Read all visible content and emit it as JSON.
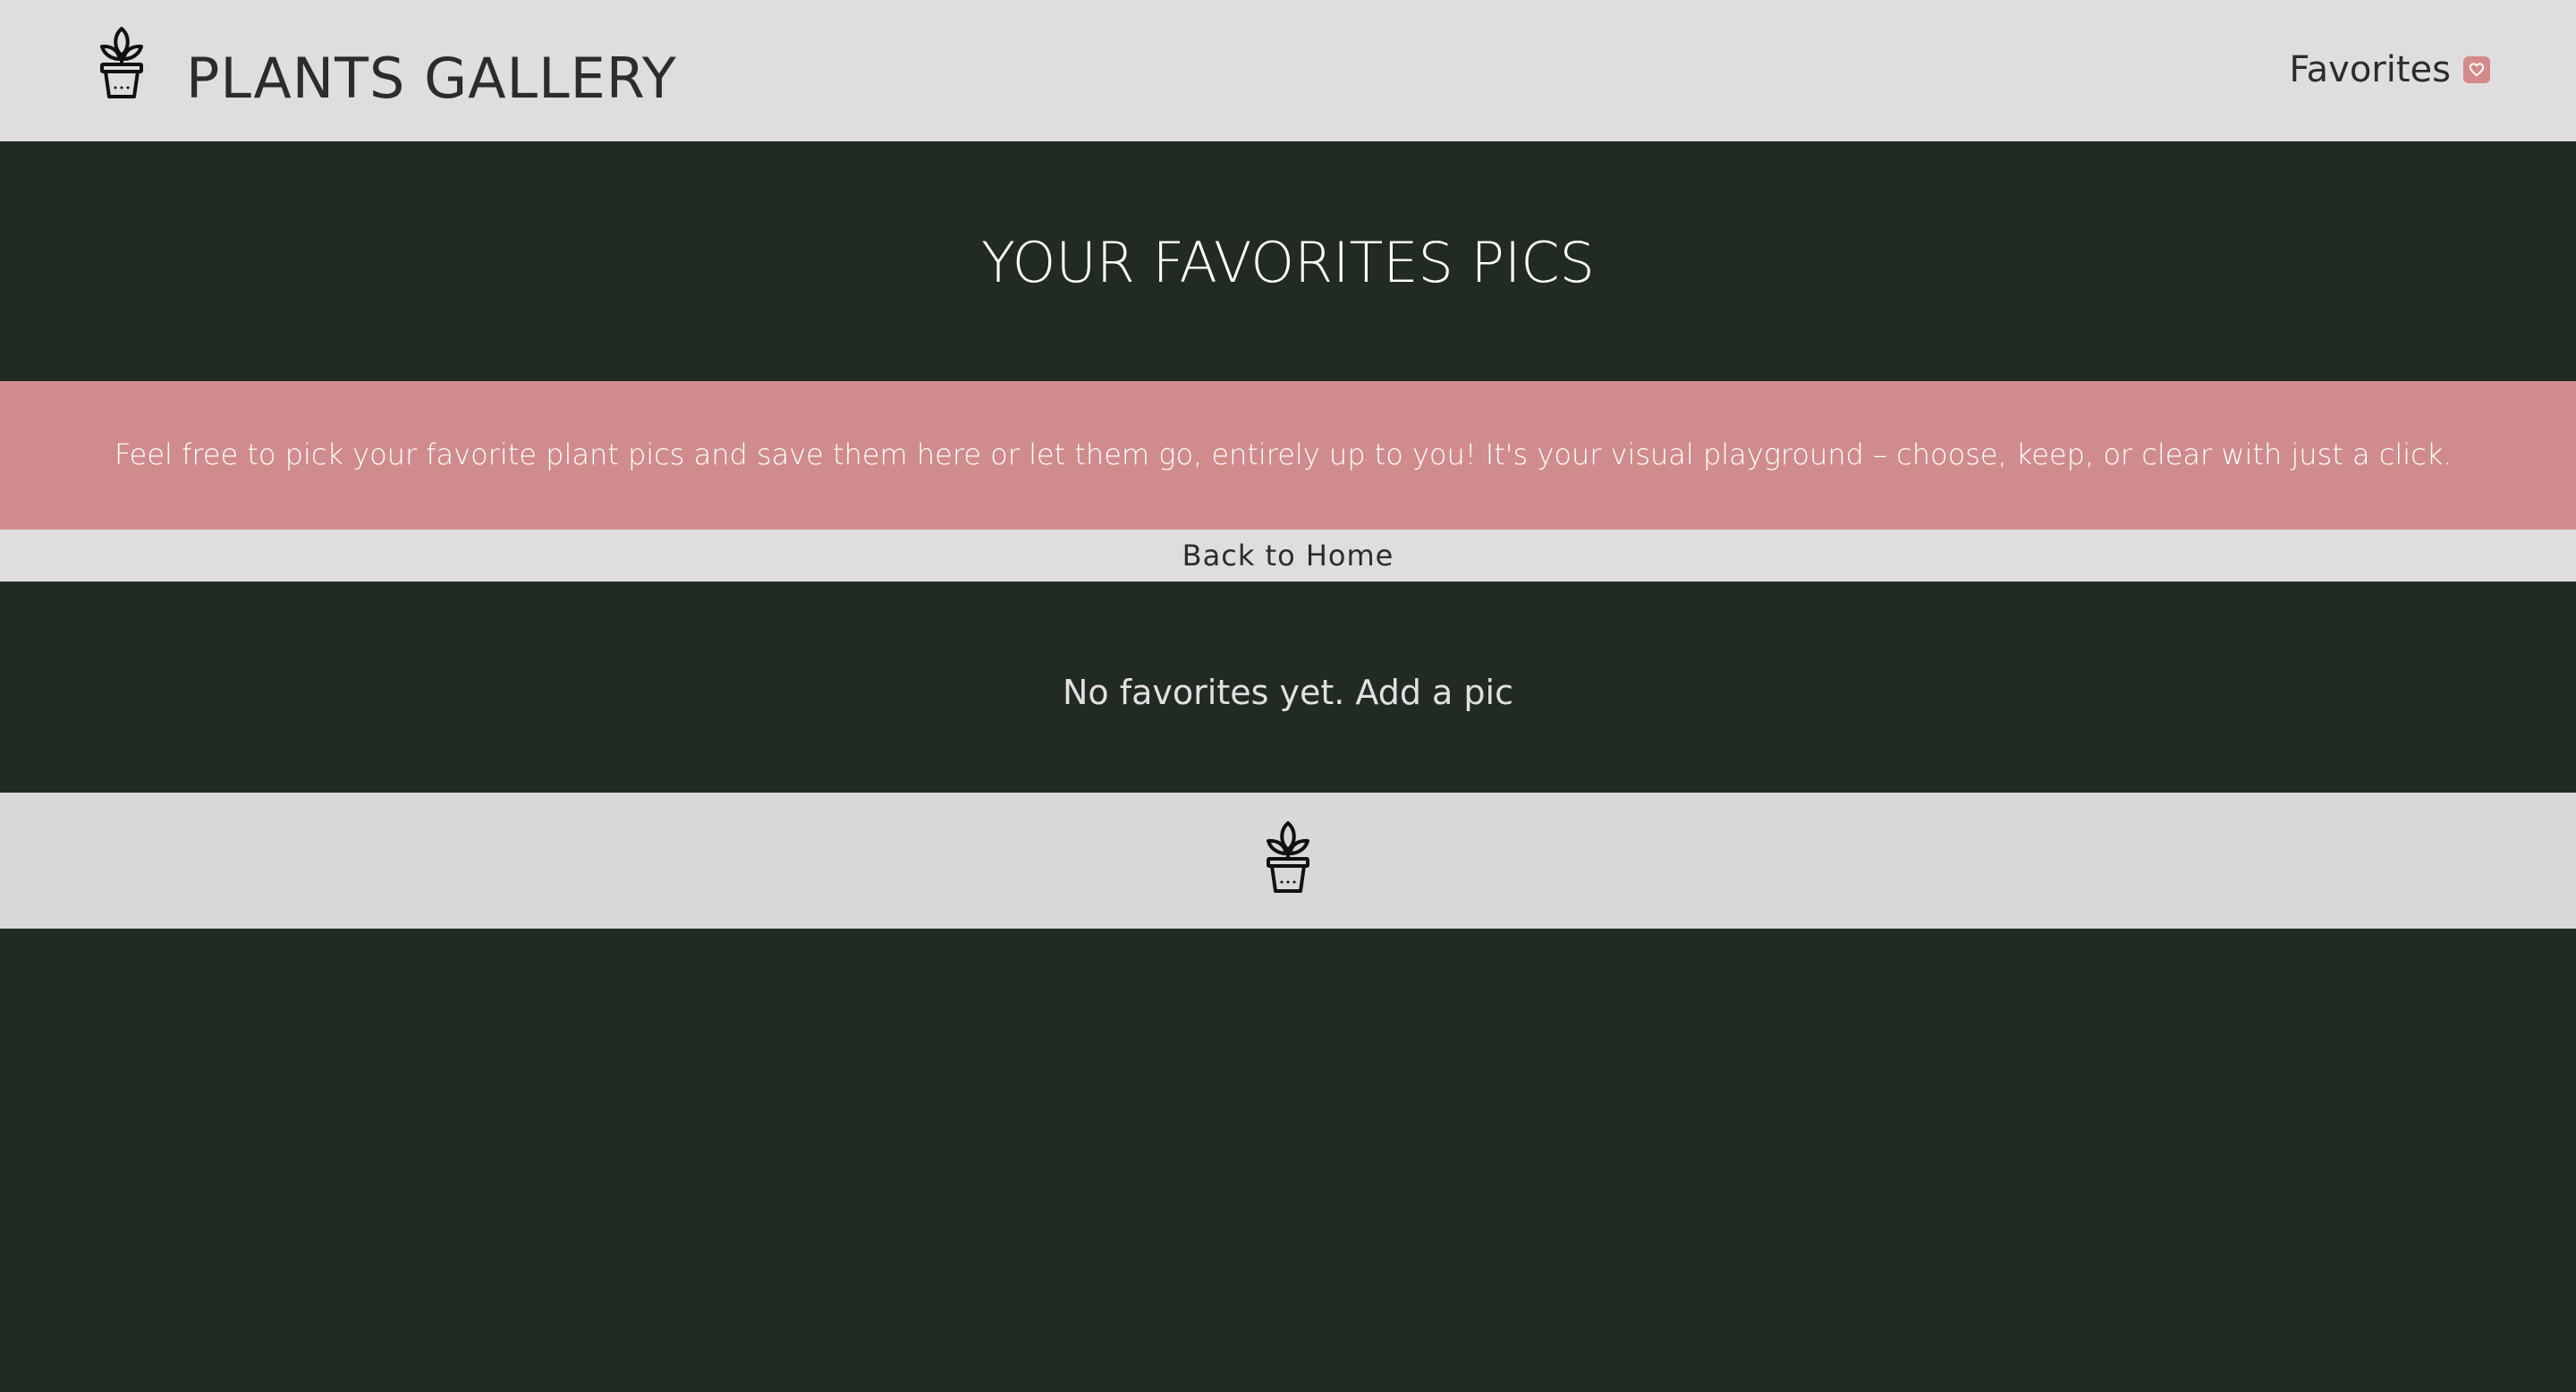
{
  "header": {
    "logo_icon": "potted-plant-icon",
    "brand_title": "PLANTS GALLERY",
    "favorites_label": "Favorites",
    "favorites_icon": "heart-icon",
    "badge_color": "#d48a8a"
  },
  "hero": {
    "title": "YOUR FAVORITES PICS"
  },
  "intro": {
    "text": "Feel free to pick your favorite plant pics and save them here or let them go, entirely up to you! It's your visual playground – choose, keep, or clear with just a click.",
    "background_color": "#d08c8c"
  },
  "nav": {
    "back_label": "Back to Home"
  },
  "main": {
    "empty_message": "No favorites yet. Add a pic"
  },
  "footer": {
    "logo_icon": "potted-plant-icon"
  },
  "colors": {
    "dark_green": "#222b22",
    "light_gray": "#dfdddf",
    "rose": "#d08c8c"
  }
}
